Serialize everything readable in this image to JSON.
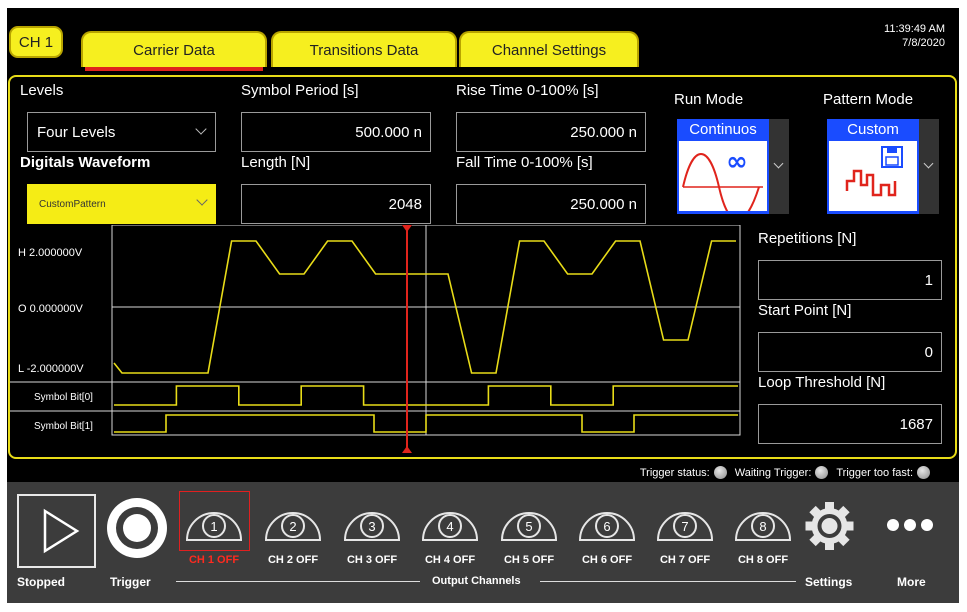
{
  "tabs": [
    {
      "label": "CH 1"
    },
    {
      "label": "Carrier Data",
      "active": true
    },
    {
      "label": "Transitions Data"
    },
    {
      "label": "Channel Settings"
    }
  ],
  "clock": {
    "time": "11:39:49 AM",
    "date": "7/8/2020"
  },
  "levels": {
    "label": "Levels",
    "value": "Four Levels"
  },
  "digital_waveform": {
    "label": "Digitals Waveform",
    "value": "CustomPattern"
  },
  "symbol_period": {
    "label": "Symbol Period [s]",
    "value": "500.000 n"
  },
  "length": {
    "label": "Length [N]",
    "value": "2048"
  },
  "rise_time": {
    "label": "Rise Time 0-100% [s]",
    "value": "250.000 n"
  },
  "fall_time": {
    "label": "Fall Time 0-100% [s]",
    "value": "250.000 n"
  },
  "run_mode": {
    "label": "Run Mode",
    "value": "Continuos"
  },
  "pattern_mode": {
    "label": "Pattern Mode",
    "value": "Custom"
  },
  "repetitions": {
    "label": "Repetitions [N]",
    "value": "1"
  },
  "start_point": {
    "label": "Start Point [N]",
    "value": "0"
  },
  "loop_threshold": {
    "label": "Loop Threshold [N]",
    "value": "1687"
  },
  "waveform": {
    "y_labels": [
      "H  2.000000V",
      "O  0.000000V",
      "L  -2.000000V"
    ],
    "bit_labels": [
      "Symbol Bit[0]",
      "Symbol Bit[1]"
    ],
    "levels": [
      -2,
      -2,
      2,
      1,
      2,
      1,
      1,
      -2,
      2,
      1,
      2,
      -1,
      2
    ],
    "bit0": [
      0,
      1,
      0,
      1,
      0,
      0,
      1,
      0,
      1,
      1
    ],
    "bit1": [
      0,
      1,
      1,
      1,
      1,
      0,
      1,
      1,
      1,
      0,
      1,
      1
    ],
    "colors": {
      "trace": "#e8dc18",
      "marker": "#e0241c"
    }
  },
  "trigger_status": {
    "status": "Trigger status:",
    "waiting": "Waiting Trigger:",
    "too_fast": "Trigger too fast:"
  },
  "bottom": {
    "stopped": "Stopped",
    "trigger": "Trigger",
    "output_channels": "Output Channels",
    "settings": "Settings",
    "more": "More",
    "channels": [
      {
        "num": "1",
        "label": "CH 1 OFF"
      },
      {
        "num": "2",
        "label": "CH 2 OFF"
      },
      {
        "num": "3",
        "label": "CH 3 OFF"
      },
      {
        "num": "4",
        "label": "CH 4 OFF"
      },
      {
        "num": "5",
        "label": "CH 5 OFF"
      },
      {
        "num": "6",
        "label": "CH 6 OFF"
      },
      {
        "num": "7",
        "label": "CH 7 OFF"
      },
      {
        "num": "8",
        "label": "CH 8 OFF"
      }
    ]
  }
}
